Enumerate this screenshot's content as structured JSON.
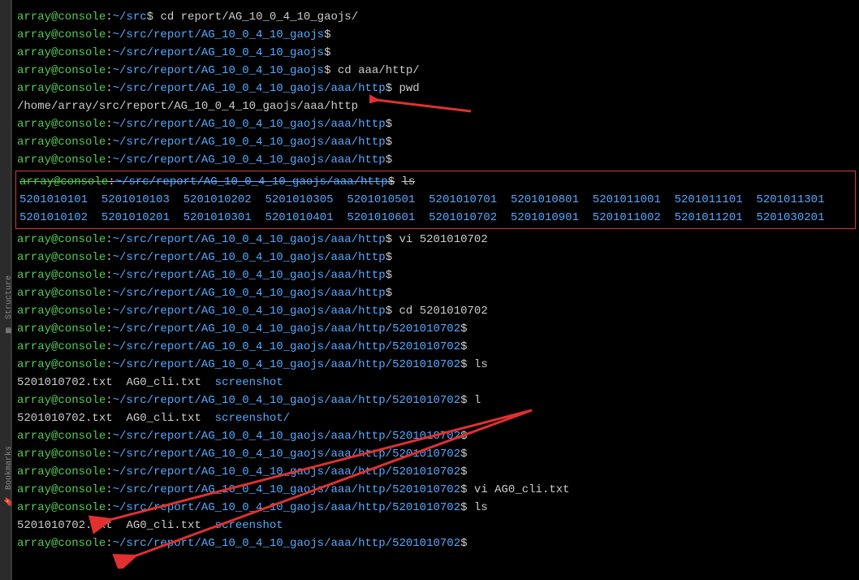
{
  "prompt": {
    "user": "array",
    "host": "console",
    "userhost": "array@console",
    "dollar": "$"
  },
  "paths": {
    "p_src": "~/src",
    "p_rep": "~/src/report/AG_10_0_4_10_gaojs",
    "p_http": "~/src/report/AG_10_0_4_10_gaojs/aaa/http",
    "p_702": "~/src/report/AG_10_0_4_10_gaojs/aaa/http/5201010702",
    "pwd_out": "/home/array/src/report/AG_10_0_4_10_gaojs/aaa/http"
  },
  "commands": {
    "cd_report": "cd report/AG_10_0_4_10_gaojs/",
    "cd_aaahttp": "cd aaa/http/",
    "pwd": "pwd",
    "ls": "ls",
    "vi_702": "vi 5201010702",
    "cd_702": "cd 5201010702",
    "l": "l",
    "vi_ag0": "vi AG0_cli.txt"
  },
  "ls_http_row1": [
    "5201010101",
    "5201010103",
    "5201010202",
    "5201010305",
    "5201010501",
    "5201010701",
    "5201010801",
    "5201011001",
    "5201011101",
    "5201011301"
  ],
  "ls_http_row2": [
    "5201010102",
    "5201010201",
    "5201010301",
    "5201010401",
    "5201010601",
    "5201010702",
    "5201010901",
    "5201011002",
    "5201011201",
    "5201030201"
  ],
  "ls_702": {
    "txt1": "5201010702.txt",
    "txt2": "AG0_cli.txt",
    "dir": "screenshot"
  },
  "l_702": {
    "txt1": "5201010702.txt",
    "txt2": "AG0_cli.txt",
    "dir": "screenshot/"
  },
  "sidebar": {
    "structure": "Structure",
    "bookmarks": "Bookmarks"
  }
}
